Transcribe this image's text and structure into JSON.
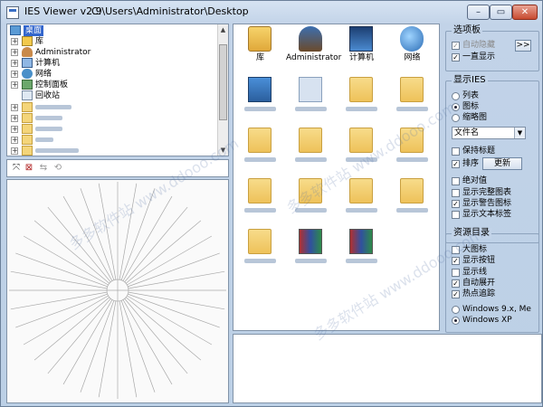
{
  "window": {
    "app_title": "IES Viewer v2.9",
    "path_title": "C:\\Users\\Administrator\\Desktop",
    "buttons": [
      "–",
      "▭",
      "✕"
    ]
  },
  "tree": {
    "items": [
      {
        "label": "桌面",
        "selected": true,
        "icon": "desktop-icon"
      },
      {
        "label": "库",
        "icon": "library-icon"
      },
      {
        "label": "Administrator",
        "icon": "user-icon"
      },
      {
        "label": "计算机",
        "icon": "computer-icon"
      },
      {
        "label": "网络",
        "icon": "network-icon"
      },
      {
        "label": "控制面板",
        "icon": "control-panel-icon"
      },
      {
        "label": "回收站",
        "icon": "recycle-bin-icon"
      }
    ],
    "blurred_folder_rows": 6
  },
  "toolbar_icons": [
    "fit-icon",
    "grid-toggle-icon",
    "flip-icon",
    "rotate-icon"
  ],
  "file_icons": [
    {
      "label": "库",
      "icon": "library-icon"
    },
    {
      "label": "Administrator",
      "icon": "user-icon"
    },
    {
      "label": "计算机",
      "icon": "computer-icon"
    },
    {
      "label": "网络",
      "icon": "network-icon"
    }
  ],
  "blurred_file_icons": [
    "app-icon",
    "doc-icon",
    "folder-icon",
    "folder-icon",
    "folder-icon",
    "folder-icon",
    "folder-icon",
    "folder-icon",
    "folder-icon",
    "folder-icon",
    "folder-icon",
    "folder-icon",
    "folder-icon",
    "zip-icon",
    "zip-icon"
  ],
  "options": {
    "title": "选项板",
    "auto_hide": "自动隐藏",
    "always_show": "一直显示",
    "expand": ">>"
  },
  "display_ies": {
    "title": "显示IES",
    "view_list": "列表",
    "view_icon": "图标",
    "view_thumb": "缩略图",
    "sort_select": "文件名",
    "keep_title": "保持标题",
    "sort": "排序",
    "refresh": "更新",
    "absolute": "绝对值",
    "show_full": "显示完整图表",
    "show_warn": "显示警告图标",
    "show_text": "显示文本标签"
  },
  "resources": {
    "title": "资源目录",
    "large_icons": "大图标",
    "show_buttons": "显示按钮",
    "show_lines": "显示线",
    "auto_expand": "自动展开",
    "hot_track": "热点追踪",
    "win9x": "Windows 9.x, Me",
    "winxp": "Windows XP"
  },
  "watermark": "多多软件站 www.ddooo.com"
}
